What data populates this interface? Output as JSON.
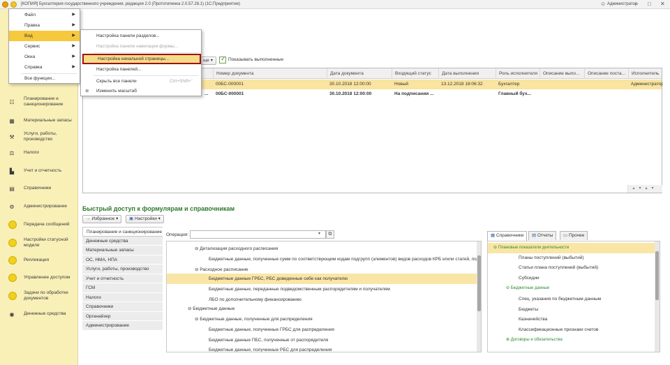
{
  "titlebar": {
    "title": "[КОПИЯ] Бухгалтерия государственного учреждения, редакция 2.0 (Прототипенка 2.0.57.28.1)  (1С:Предприятие)",
    "user": "Администратор"
  },
  "main_menu": [
    {
      "label": "Файл"
    },
    {
      "label": "Правка"
    },
    {
      "label": "Вид"
    },
    {
      "label": "Сервис"
    },
    {
      "label": "Окна"
    },
    {
      "label": "Справка"
    },
    {
      "label": "Все функции..."
    }
  ],
  "view_submenu": [
    {
      "label": "Настройка панели разделов...",
      "shortcut": "",
      "disabled": false
    },
    {
      "label": "Настройка панели навигации формы...",
      "shortcut": "",
      "disabled": true
    },
    {
      "label": "Настройка начальной страницы...",
      "shortcut": "",
      "disabled": false,
      "highlighted": true
    },
    {
      "label": "Настройка панелей...",
      "shortcut": "",
      "disabled": false
    },
    {
      "label": "Скрыть все панели",
      "shortcut": "Ctrl+Shift+`",
      "disabled": false
    },
    {
      "label": "Изменить масштаб",
      "shortcut": "",
      "disabled": false
    }
  ],
  "sidebar": {
    "items": [
      {
        "label": "Планирование и санкционирование",
        "icon": "planning-icon"
      },
      {
        "label": "Материальные запасы",
        "icon": "materials-icon"
      },
      {
        "label": "Услуги, работы, производство",
        "icon": "services-icon"
      },
      {
        "label": "Налоги",
        "icon": "taxes-icon"
      },
      {
        "label": "Учет и отчетность",
        "icon": "accounting-icon"
      },
      {
        "label": "Справочники",
        "icon": "catalogs-icon"
      },
      {
        "label": "Администрирование",
        "icon": "gear-icon"
      },
      {
        "label": "Передача сообщений",
        "icon": "circle-icon"
      },
      {
        "label": "Настройки статусной модели",
        "icon": "circle-icon"
      },
      {
        "label": "Репликация",
        "icon": "circle-icon"
      },
      {
        "label": "Управление доступом",
        "icon": "circle-icon"
      },
      {
        "label": "Задачи по обработке документов",
        "icon": "circle-icon"
      },
      {
        "label": "Денежные средства",
        "icon": "money-icon"
      }
    ]
  },
  "toolbar": {
    "dropdown_label": "ще",
    "show_completed_label": "Показывать выполненные",
    "show_completed": true
  },
  "grid": {
    "columns": [
      "Номер документа",
      "Дата документа",
      "Входящий статус",
      "Дата выполнения",
      "Роль исполнителя",
      "Описание выпо...",
      "Описание поста...",
      "Исполнитель"
    ],
    "rows": [
      {
        "prefix": "",
        "number": "00БС-000001",
        "date": "30.10.2018 12:00:00",
        "status": "Новый",
        "done_date": "13.12.2018 18:06:32",
        "role": "Бухгалтер",
        "desc1": "",
        "desc2": "",
        "executor": "Администратор"
      },
      {
        "prefix": "...",
        "number": "00БС-000001",
        "date": "30.10.2018 12:00:00",
        "status": "На подписании ...",
        "done_date": "",
        "role": "Главный бух...",
        "desc1": "",
        "desc2": "",
        "executor": ""
      }
    ]
  },
  "quick_access": {
    "title": "Быстрый доступ к формулярам и справочникам",
    "favorites_label": "Избранное",
    "settings_label": "Настройки",
    "operation_label": "Операция:",
    "operation_value": ""
  },
  "left_list": [
    "Планирование и санкционирование",
    "Денежные средства",
    "Материальные запасы",
    "ОС, НМА, НПА",
    "Услуги, работы, производство",
    "Учет и отчетность",
    "ГСМ",
    "Налоги",
    "Справочники",
    "Органайзер",
    "Администрирование"
  ],
  "tree": [
    {
      "label": "Детализация расходного расписания",
      "level": 1,
      "expander": "⊖"
    },
    {
      "label": "Бюджетные данные, полученные сумм по соответствующим кодам подгрупп (элементов) видов расходов КРБ и/или статей, подст...",
      "level": 2,
      "expander": ""
    },
    {
      "label": "Расходное расписание",
      "level": 1,
      "expander": "⊖"
    },
    {
      "label": "Бюджетные данные ГРБС, РБС доведенные себе как получателю",
      "level": 2,
      "expander": "",
      "highlighted": true
    },
    {
      "label": "Бюджетные данные, переданные подведомственным распорядителям и получателям",
      "level": 2,
      "expander": ""
    },
    {
      "label": "ЛБО по дополнительному финансированию",
      "level": 2,
      "expander": ""
    },
    {
      "label": "Бюджетные данные",
      "level": 0,
      "expander": "⊖"
    },
    {
      "label": "Бюджетные данные, полученные для распределения",
      "level": 1,
      "expander": "⊖"
    },
    {
      "label": "Бюджетные данные, полученные ГРБС для распределения",
      "level": 2,
      "expander": ""
    },
    {
      "label": "Бюджетные данные ПБС, полученные от распорядителя",
      "level": 2,
      "expander": ""
    },
    {
      "label": "Бюджетные данные, полученные РБС для распределения",
      "level": 2,
      "expander": ""
    }
  ],
  "right_tabs": [
    "Справочники",
    "Отчеты",
    "Прочее"
  ],
  "right_list": [
    {
      "label": "Плановые показатели деятельности",
      "group": true,
      "highlighted": true
    },
    {
      "label": "Планы поступлений (выбытий)",
      "group": false
    },
    {
      "label": "Статьи плана поступлений (выбытий)",
      "group": false
    },
    {
      "label": "Субсидии",
      "group": false
    },
    {
      "label": "Бюджетные данные",
      "group": true
    },
    {
      "label": "Спец. указания по бюджетным данным",
      "group": false
    },
    {
      "label": "Бюджеты",
      "group": false
    },
    {
      "label": "Казначейства",
      "group": false
    },
    {
      "label": "Классификационные признаки счетов",
      "group": false
    },
    {
      "label": "Договоры и обязательства",
      "group": true
    }
  ]
}
